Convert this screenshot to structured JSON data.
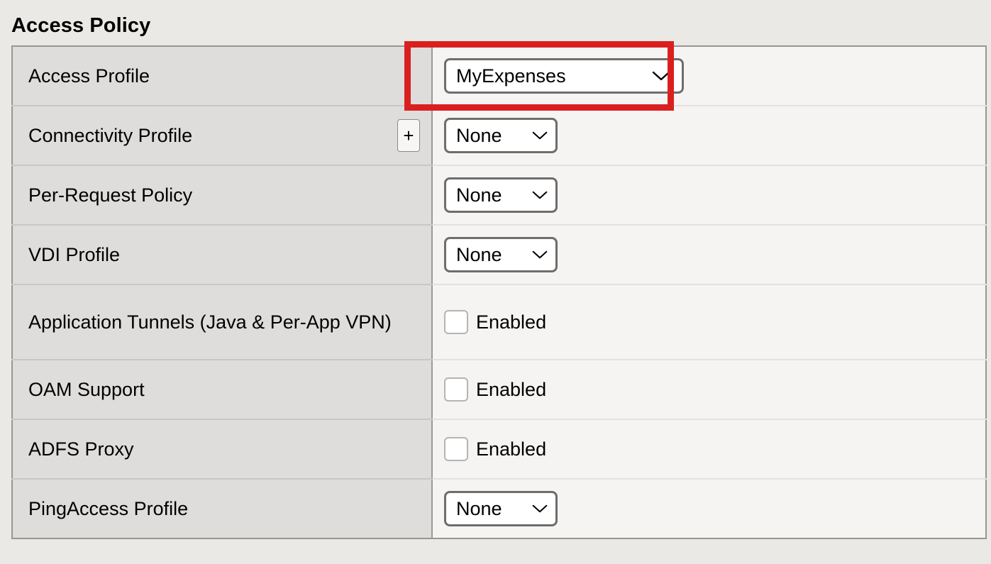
{
  "page": {
    "title": "Access Policy",
    "background_color": "#eae9e6"
  },
  "highlight": {
    "color": "#d9201f",
    "target": "access-profile-select"
  },
  "table": {
    "rows": [
      {
        "label": "Access Profile",
        "control": "select",
        "value": "MyExpenses",
        "has_plus": false,
        "highlighted": true
      },
      {
        "label": "Connectivity Profile",
        "control": "select",
        "value": "None",
        "has_plus": true,
        "plus_label": "+",
        "highlighted": false
      },
      {
        "label": "Per-Request Policy",
        "control": "select",
        "value": "None",
        "has_plus": false,
        "highlighted": false
      },
      {
        "label": "VDI Profile",
        "control": "select",
        "value": "None",
        "has_plus": false,
        "highlighted": false
      },
      {
        "label": "Application Tunnels (Java & Per-App VPN)",
        "control": "checkbox",
        "value": "Enabled",
        "checked": false,
        "has_plus": false,
        "highlighted": false
      },
      {
        "label": "OAM Support",
        "control": "checkbox",
        "value": "Enabled",
        "checked": false,
        "has_plus": false,
        "highlighted": false
      },
      {
        "label": "ADFS Proxy",
        "control": "checkbox",
        "value": "Enabled",
        "checked": false,
        "has_plus": false,
        "highlighted": false
      },
      {
        "label": "PingAccess Profile",
        "control": "select",
        "value": "None",
        "has_plus": false,
        "highlighted": false
      }
    ]
  },
  "icons": {
    "chevron_down": "chevron-down-icon",
    "plus": "plus-icon"
  }
}
